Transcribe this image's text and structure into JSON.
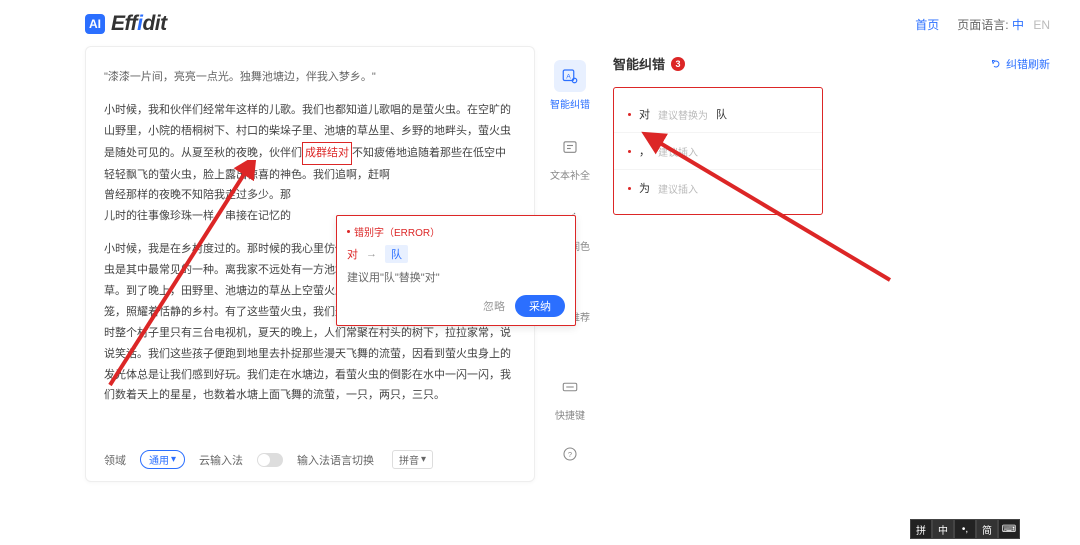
{
  "header": {
    "logo_badge": "AI",
    "logo_pre": "Eff",
    "logo_blue": "i",
    "logo_post": "dit",
    "nav_home": "首页",
    "nav_lang_label": "页面语言:",
    "lang_zh": "中",
    "lang_en": "EN"
  },
  "editor": {
    "quote": "\"漆漆一片间，亮亮一点光。独舞池塘边，伴我入梦乡。\"",
    "p1_a": "小时候，我和伙伴们经常年这样的儿歌。我们也都知道儿歌唱的是萤火虫。在空旷的山野里，小院的梧桐树下、村口的柴垛子里、池塘的草丛里、乡野的地畔头，萤火虫是随处可见的。从夏至秋的夜晚，伙伴们",
    "err_inline": "成群结对",
    "p1_b": "不知疲倦地追随着那些在低空中轻轻飘飞的萤火虫，脸上露出惊喜的神色。我们追啊，赶啊",
    "p1_c": "曾经那样的夜晚不知陪我走过多少。那",
    "p1_d": "儿时的往事像珍珠一样，串接在记忆的",
    "p2": "小时候，我是在乡村度过的。那时候的我心里仿佛是一首纯净的田园牧歌。看，萤火虫是其中最常见的一种。离我家不远处有一方池塘，夏天的时候，池塘边长满了野草。到了晚上，田野里、池塘边的草丛上空萤火虫飞来飞去，就像一个个小小的灯笼，照耀着恬静的乡村。有了这些萤火虫，我们这些顽皮的孩子便有了很多趣事。那时整个村子里只有三台电视机，夏天的晚上，人们常聚在村头的树下，拉拉家常，说说笑话。我们这些孩子便跑到地里去扑捉那些漫天飞舞的流萤，因看到萤火虫身上的发光体总是让我们感到好玩。我们走在水塘边，看萤火虫的倒影在水中一闪一闪，我们数着天上的星星，也数着水塘上面飞舞的流萤，一只，两只，三只。"
  },
  "popup": {
    "header": "错别字（ERROR）",
    "from": "对",
    "arrow": "→",
    "to": "队",
    "desc": "建议用\"队\"替换\"对\"",
    "ignore": "忽略",
    "accept": "采纳"
  },
  "footer": {
    "domain_label": "领域",
    "domain_value": "通用",
    "cloud_ime": "云输入法",
    "ime_label": "输入法语言切换",
    "ime_value": "拼音"
  },
  "tools": {
    "t1": "智能纠错",
    "t2": "文本补全",
    "t3": "文本润色",
    "t4": "例句推荐",
    "bottom1": "快捷键"
  },
  "right": {
    "title": "智能纠错",
    "badge": "3",
    "refresh": "纠错刷新",
    "items": [
      {
        "word": "对",
        "hint": "建议替换为",
        "repl": "队"
      },
      {
        "word": "，",
        "hint": "建议插入",
        "repl": ""
      },
      {
        "word": "为",
        "hint": "建议插入",
        "repl": ""
      }
    ]
  },
  "osbar": {
    "i1": "拼",
    "i2": "中",
    "i3": "•,",
    "i4": "简",
    "i5": "⌨"
  }
}
